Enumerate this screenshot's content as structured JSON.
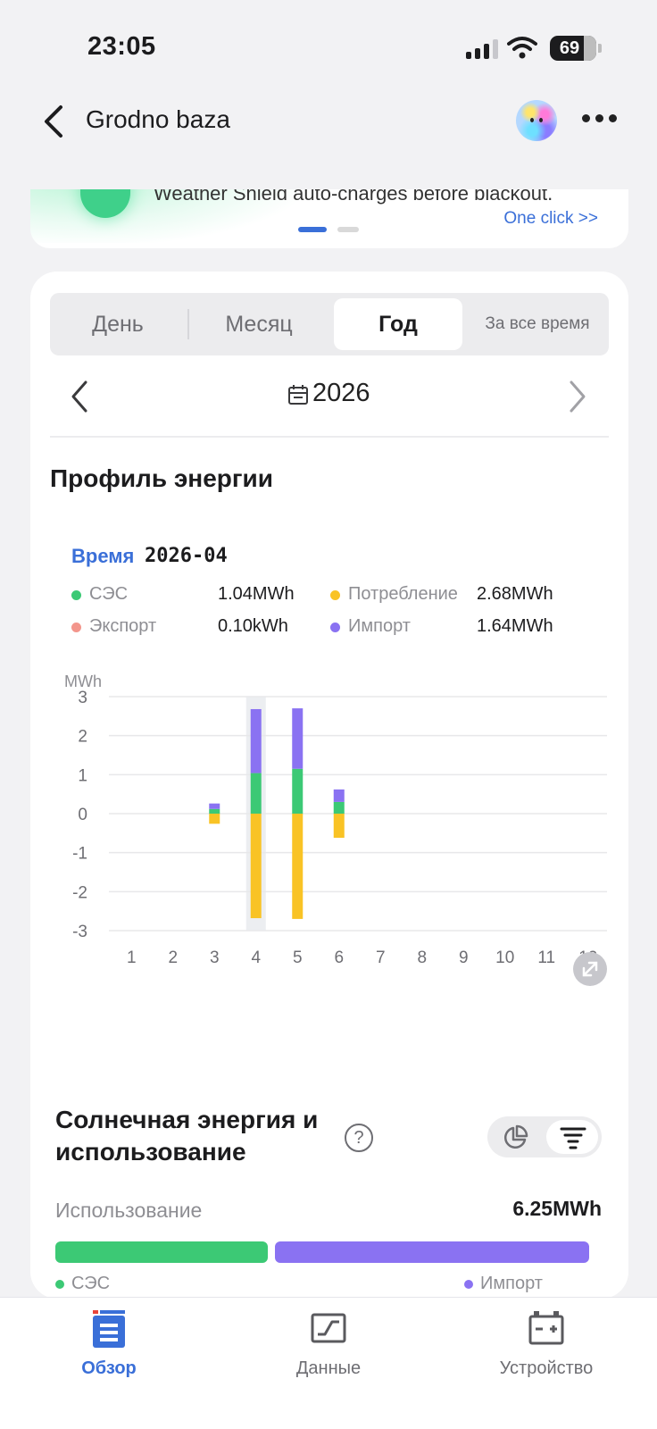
{
  "status_bar": {
    "time": "23:05",
    "battery": "69"
  },
  "header": {
    "title": "Grodno baza"
  },
  "banner": {
    "text": "Weather Shield auto-charges before blackout.",
    "cta": "One click >>"
  },
  "tabs": [
    {
      "label": "День",
      "active": false
    },
    {
      "label": "Месяц",
      "active": false
    },
    {
      "label": "Год",
      "active": true
    },
    {
      "label": "За все время",
      "active": false
    }
  ],
  "period": {
    "year": "2026"
  },
  "energy_profile": {
    "title": "Профиль энергии",
    "tooltip": {
      "label": "Время",
      "value": "2026-04",
      "items": [
        {
          "name": "СЭС",
          "value": "1.04MWh",
          "color": "#3cc975"
        },
        {
          "name": "Потребление",
          "value": "2.68MWh",
          "color": "#f9c325"
        },
        {
          "name": "Экспорт",
          "value": "0.10kWh",
          "color": "#f3968c"
        },
        {
          "name": "Импорт",
          "value": "1.64MWh",
          "color": "#8a72f2"
        }
      ]
    }
  },
  "chart_data": {
    "type": "bar",
    "stacked": true,
    "ylabel": "MWh",
    "ylim": [
      -3,
      3
    ],
    "yticks": [
      "3",
      "2",
      "1",
      "0",
      "-1",
      "-2",
      "-3"
    ],
    "categories": [
      "1",
      "2",
      "3",
      "4",
      "5",
      "6",
      "7",
      "8",
      "9",
      "10",
      "11",
      "12"
    ],
    "highlighted_category": "4",
    "grid": true,
    "series": [
      {
        "name": "СЭС",
        "color": "#3cc975",
        "values": [
          0,
          0,
          0.12,
          1.04,
          1.15,
          0.3,
          0,
          0,
          0,
          0,
          0,
          0
        ]
      },
      {
        "name": "Импорт",
        "color": "#8a72f2",
        "values": [
          0,
          0,
          0.14,
          1.64,
          1.55,
          0.32,
          0,
          0,
          0,
          0,
          0,
          0
        ]
      },
      {
        "name": "Потребление",
        "color": "#f9c325",
        "values": [
          0,
          0,
          -0.26,
          -2.68,
          -2.7,
          -0.62,
          0,
          0,
          0,
          0,
          0,
          0
        ]
      },
      {
        "name": "Экспорт",
        "color": "#f3968c",
        "values": [
          0,
          0,
          0,
          0,
          0,
          0,
          0,
          0,
          0,
          0,
          0,
          0
        ]
      }
    ]
  },
  "solar_section": {
    "title": "Солнечная энергия и использование",
    "usage_label": "Использование",
    "usage_value": "6.25MWh",
    "pv_share": 0.404,
    "legend_pv": "СЭС",
    "legend_import": "Импорт"
  },
  "bottom_nav": [
    {
      "label": "Обзор",
      "icon": "overview-icon",
      "active": true
    },
    {
      "label": "Данные",
      "icon": "chart-icon",
      "active": false
    },
    {
      "label": "Устройство",
      "icon": "device-icon",
      "active": false
    }
  ],
  "colors": {
    "accent": "#3a6fd8",
    "pv": "#3cc975",
    "import": "#8a72f2",
    "consumption": "#f9c325",
    "export": "#f3968c"
  }
}
